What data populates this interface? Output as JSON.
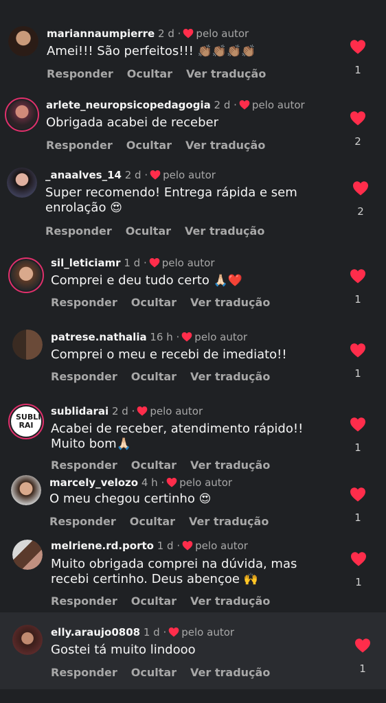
{
  "colors": {
    "background": "#1f2124",
    "heart": "#ff2d4b",
    "muted": "#a8a8a8",
    "story_ring": "#e1306c"
  },
  "icons": {
    "like": "heart-icon"
  },
  "comments": [
    {
      "username": "mariannaumpierre",
      "time": "2 d",
      "by_author": "pelo autor",
      "text": "Amei!!! São perfeitos!!!",
      "emoji": "👏🏽👏🏽👏🏽👏🏽",
      "reply": "Responder",
      "hide": "Ocultar",
      "translate": "Ver tradução",
      "likes": "1"
    },
    {
      "username": "arlete_neuropsicopedagogia",
      "time": "2 d",
      "by_author": "pelo autor",
      "text": "Obrigada acabei de receber",
      "emoji": "",
      "reply": "Responder",
      "hide": "Ocultar",
      "translate": "Ver tradução",
      "likes": "2"
    },
    {
      "username": "_anaalves_14",
      "time": "2 d",
      "by_author": "pelo autor",
      "text": "Super recomendo! Entrega rápida e sem enrolação",
      "emoji": "😍",
      "reply": "Responder",
      "hide": "Ocultar",
      "translate": "Ver tradução",
      "likes": "2"
    },
    {
      "username": "sil_leticiamr",
      "time": "1 d",
      "by_author": "pelo autor",
      "text": "Comprei e deu tudo certo",
      "emoji": "🙏🏻❤️",
      "reply": "Responder",
      "hide": "Ocultar",
      "translate": "Ver tradução",
      "likes": "1"
    },
    {
      "username": "patrese.nathalia",
      "time": "16 h",
      "by_author": "pelo autor",
      "text": "Comprei o meu e recebi de imediato!!",
      "emoji": "",
      "reply": "Responder",
      "hide": "Ocultar",
      "translate": "Ver tradução",
      "likes": "1"
    },
    {
      "username": "sublidarai",
      "time": "2 d",
      "by_author": "pelo autor",
      "text": "Acabei de receber, atendimento rápido!! Muito bom",
      "emoji": "🙏🏻",
      "reply": "Responder",
      "hide": "Ocultar",
      "translate": "Ver tradução",
      "likes": "1",
      "avatar_logo": "SUBLI RAI"
    },
    {
      "username": "marcely_velozo",
      "time": "4 h",
      "by_author": "pelo autor",
      "text": "O meu chegou certinho",
      "emoji": "😍",
      "reply": "Responder",
      "hide": "Ocultar",
      "translate": "Ver tradução",
      "likes": "1"
    },
    {
      "username": "melriene.rd.porto",
      "time": "1 d",
      "by_author": "pelo autor",
      "text": "Muito obrigada comprei na dúvida, mas recebi certinho. Deus abençoe",
      "emoji": "🙌",
      "reply": "Responder",
      "hide": "Ocultar",
      "translate": "Ver tradução",
      "likes": "1"
    },
    {
      "username": "elly.araujo0808",
      "time": "1 d",
      "by_author": "pelo autor",
      "text": "Gostei tá muito lindooo",
      "emoji": "",
      "reply": "Responder",
      "hide": "Ocultar",
      "translate": "Ver tradução",
      "likes": "1"
    }
  ]
}
